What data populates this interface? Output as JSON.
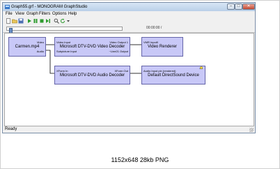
{
  "window": {
    "title": "Graph55.grf - MONOGRAM GraphStudio"
  },
  "menu": [
    "File",
    "View",
    "Graph",
    "Filters",
    "Options",
    "Help"
  ],
  "toolbar": {
    "icons": [
      "new-icon",
      "open-icon",
      "save-icon",
      "play-icon",
      "pause-icon",
      "stop-icon",
      "step-icon",
      "search-icon",
      "refresh-icon",
      "dropdown-icon"
    ]
  },
  "seek": {
    "position": 0.02,
    "time": "00:00:00 /"
  },
  "filters": {
    "source": {
      "name": "Carmen.mp4",
      "pins": {
        "video_out": "Video",
        "audio_out": "Audio"
      }
    },
    "video_decoder": {
      "name": "Microsoft DTV-DVD Video Decoder",
      "pins": {
        "video_in": "Video Input",
        "subpicture_in": "Subpicture Input",
        "video_out": "Video Output 1",
        "line21_out": "~Line21 Output"
      }
    },
    "video_renderer": {
      "name": "Video Renderer",
      "pins": {
        "vmr_in": "VMR Input0"
      }
    },
    "audio_decoder": {
      "name": "Microsoft DTV-DVD Audio Decoder",
      "pins": {
        "xform_in": "XForm In",
        "xform_out": "XForm Out"
      }
    },
    "audio_renderer": {
      "name": "Default DirectSound Device",
      "pins": {
        "audio_in": "Audio Input pin (rendered)"
      },
      "clock_badge": "#0"
    }
  },
  "status": "Ready",
  "caption": "1152x648 28kb PNG",
  "colors": {
    "filter_fill": "#c8c8f7",
    "filter_border": "#6464a8",
    "connection": "#000000"
  }
}
